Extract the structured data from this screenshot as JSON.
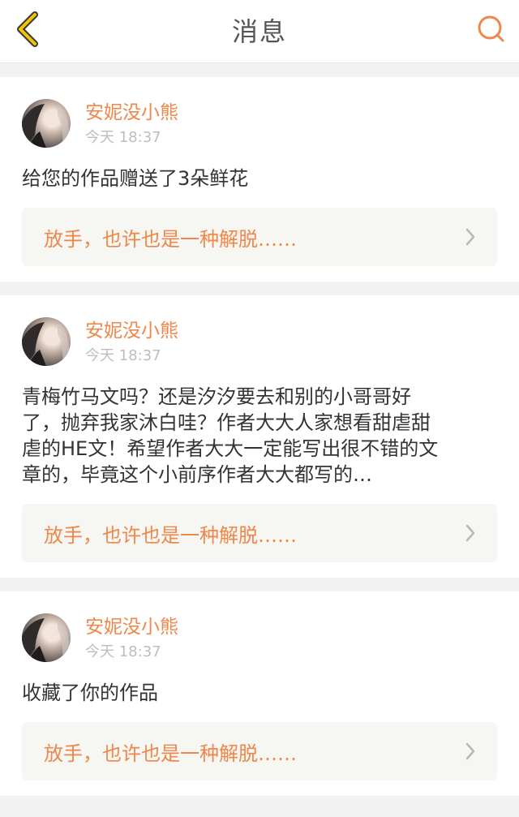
{
  "header": {
    "title": "消息",
    "accent_color": "#f5b400",
    "search_color": "#f0874a"
  },
  "messages": [
    {
      "username": "安妮没小熊",
      "time": "今天 18:37",
      "content": "给您的作品赠送了3朵鲜花",
      "work_title": "放手，也许也是一种解脱……"
    },
    {
      "username": "安妮没小熊",
      "time": "今天 18:37",
      "content": "青梅竹马文吗？还是汐汐要去和别的小哥哥好\n了，抛弃我家沐白哇？作者大大人家想看甜虐甜\n虐的HE文！希望作者大大一定能写出很不错的文\n章的，毕竟这个小前序作者大大都写的…",
      "work_title": "放手，也许也是一种解脱……"
    },
    {
      "username": "安妮没小熊",
      "time": "今天 18:37",
      "content": "收藏了你的作品",
      "work_title": "放手，也许也是一种解脱……"
    }
  ]
}
